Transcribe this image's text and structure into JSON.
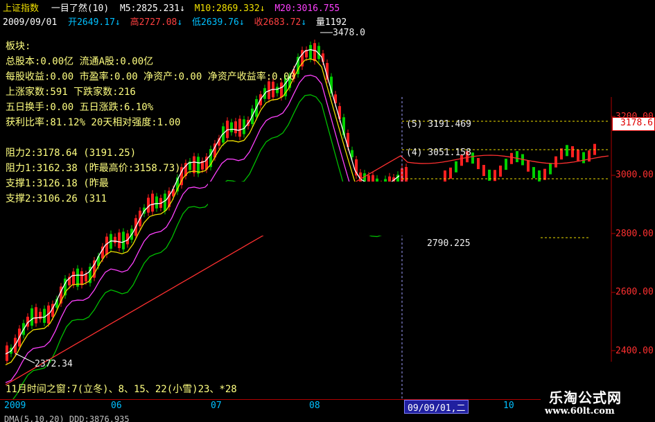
{
  "header": {
    "index_name": "上证指数",
    "formula": "一目了然(10)",
    "m5_label": "M5:2825.231",
    "m5_arrow": "↓",
    "m10_label": "M10:2869.332",
    "m10_arrow": "↓",
    "m20_label": "M20:3016.755",
    "date": "2009/09/01",
    "open_label": "开2649.17",
    "open_arrow": "↓",
    "high_label": "高2727.08",
    "high_arrow": "↓",
    "low_label": "低2639.76",
    "low_arrow": "↓",
    "close_label": "收2683.72",
    "close_arrow": "↓",
    "volume_label": "量1192"
  },
  "info_panel": {
    "sector": "板块:",
    "capital": "总股本:0.00亿  流通A股:0.00亿",
    "valuation": "每股收益:0.00 市盈率:0.00 净资产:0.00 净资产收益率:0.00",
    "adv_dec": "上涨家数:591   下跌家数:216",
    "turnover": "五日换手:0.00   五日涨跌:6.10%",
    "profit": "获利比率:81.12%  20天相对强度:1.00",
    "resist2": "阻力2:3178.64  (3191.25)",
    "resist1": "阻力1:3162.38  (昨最高价:3158.73)",
    "support1": "支撑1:3126.18  (昨最",
    "support2": "支撑2:3106.26  (311"
  },
  "annotations": {
    "peak_value": "3478.0",
    "trough_value": "2372.34",
    "level_5": "(5) 3191.469",
    "level_4": "(4) 3051.158",
    "level_low": "2790.225",
    "time_window": "11月时间之窗:7(立冬)、8、15、22(小雪)23、*28"
  },
  "price_axis": {
    "current_price": "3178.6",
    "labels": [
      "3200.00",
      "3000.00",
      "2800.00",
      "2600.00",
      "2400.00"
    ]
  },
  "x_axis": {
    "labels": [
      "2009",
      "06",
      "07",
      "08",
      "10"
    ],
    "cursor_date": "09/09/01,二"
  },
  "footer_partial": "DMA(5,10,20) DDD:3876.935",
  "watermark": {
    "title": "乐淘公式网",
    "url": "www.60lt.com"
  },
  "colors": {
    "background": "#000000",
    "up_candle": "#ff2020",
    "down_candle": "#00d000",
    "ma5": "#ffffff",
    "ma10": "#f0e000",
    "ma20": "#ff40ff",
    "ma60": "#00c000",
    "ma120": "#ff3030"
  }
}
